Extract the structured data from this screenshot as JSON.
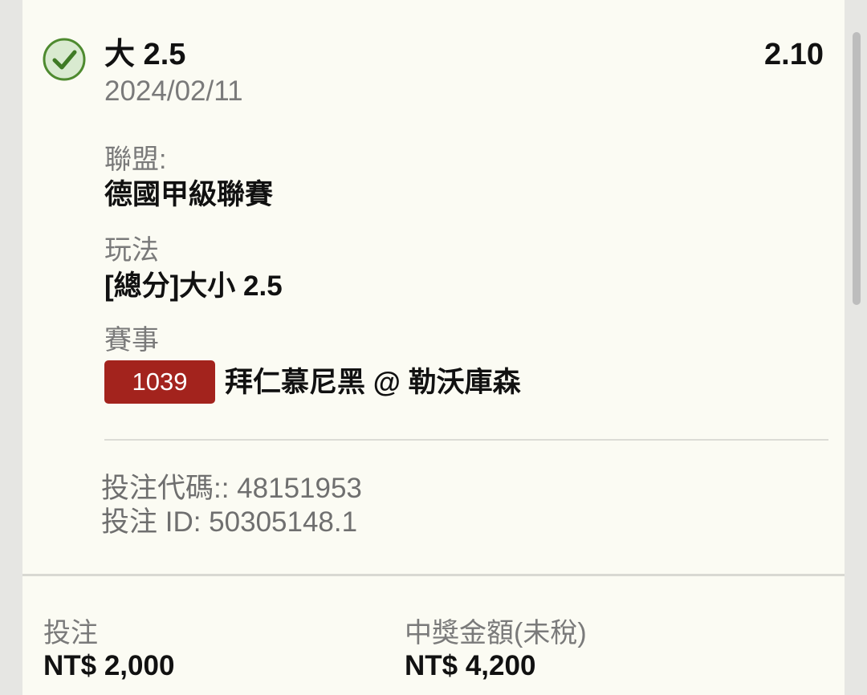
{
  "bet": {
    "selection": "大 2.5",
    "odds": "2.10",
    "date": "2024/02/11",
    "status_icon": "check-circle-icon",
    "league_label": "聯盟:",
    "league_value": "德國甲級聯賽",
    "market_label": "玩法",
    "market_value": "[總分]大小 2.5",
    "event_label": "賽事",
    "event_code": "1039",
    "event_name": "拜仁慕尼黑 @ 勒沃庫森",
    "bet_code": "投注代碼:: 48151953",
    "bet_id": "投注 ID: 50305148.1"
  },
  "footer": {
    "stake_label": "投注",
    "stake_value": "NT$ 2,000",
    "payout_label": "中獎金額(未稅)",
    "payout_value": "NT$ 4,200"
  },
  "colors": {
    "accent_green": "#4e8a2f",
    "badge_red": "#a3231d",
    "card_bg": "#fbfbf3"
  }
}
